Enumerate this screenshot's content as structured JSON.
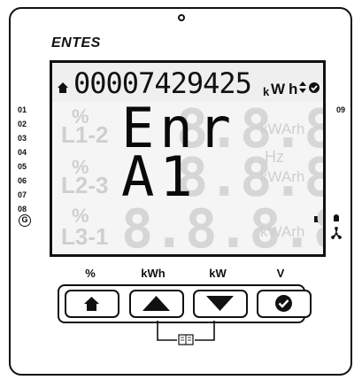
{
  "brand": {
    "logo_text": "ENTES"
  },
  "display": {
    "counter": "00007429425",
    "counter_unit_k": "k",
    "counter_unit_w": "W",
    "counter_unit_h": "h",
    "row1_text": "Enr",
    "row2_text": "A1",
    "row3_text": "8.8.8.8",
    "row1_unit": "kWArh",
    "row2_unit_top": "Hz",
    "row2_unit": "kWArh",
    "row3_unit": "kWArh",
    "row1_phase": "L1-2",
    "row2_phase": "L2-3",
    "row3_phase": "L3-1",
    "percent": "%"
  },
  "left_labels": [
    "01",
    "02",
    "03",
    "04",
    "05",
    "06",
    "07",
    "08"
  ],
  "ground_label": "G",
  "right_label": "09",
  "buttons": {
    "labels": [
      "%",
      "kWh",
      "kW",
      "V"
    ],
    "keys": [
      {
        "name": "home",
        "icon": "home-icon"
      },
      {
        "name": "up",
        "icon": "triangle-up-icon"
      },
      {
        "name": "down",
        "icon": "triangle-down-icon"
      },
      {
        "name": "ok",
        "icon": "check-icon"
      }
    ]
  },
  "colors": {
    "ink": "#111111",
    "segment_off": "#d6d6d6",
    "segment_on": "#0a0a0a",
    "lcd_bg": "#f5f5f5"
  }
}
